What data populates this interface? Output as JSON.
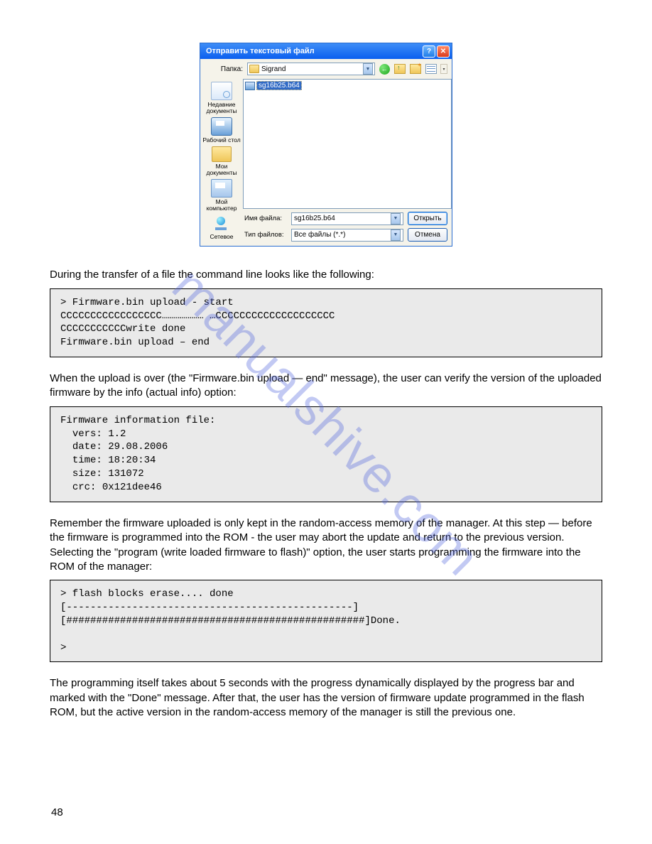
{
  "watermark": "manualshive.com",
  "dialog": {
    "title": "Отправить текстовый файл",
    "help_symbol": "?",
    "close_symbol": "✕",
    "folder_label": "Папка:",
    "folder_value": "Sigrand",
    "file_selected": "sg16b25.b64",
    "places": {
      "recent": "Недавние документы",
      "desktop": "Рабочий стол",
      "mydocs": "Мои документы",
      "mycomp": "Мой компьютер",
      "network": "Сетевое"
    },
    "filename_label": "Имя файла:",
    "filename_value": "sg16b25.b64",
    "filetype_label": "Тип файлов:",
    "filetype_value": "Все файлы (*.*)",
    "open_btn": "Открыть",
    "cancel_btn": "Отмена"
  },
  "prose1": "During the transfer of a file the command line looks like the following:",
  "codebox1": "> Firmware.bin upload - start\nCCCCCCCCCCCCCCCCC………………… …CCCCCCCCCCCCCCCCCCCC\nCCCCCCCCCCCwrite done\nFirmware.bin upload – end",
  "prose2": "When the upload is over (the \"Firmware.bin upload — end\" message), the user can verify the version of the uploaded firmware by the info (actual info) option:",
  "codebox2": "Firmware information file:\n  vers: 1.2\n  date: 29.08.2006\n  time: 18:20:34\n  size: 131072\n  crc: 0x121dee46",
  "prose3": "Remember the firmware uploaded is only kept in the random-access memory of the manager. At this step — before the firmware is programmed into the ROM - the user may abort the update and return to the previous version. Selecting the \"program (write loaded firmware to flash)\" option, the user starts programming the firmware into the ROM of the manager:",
  "codebox3": "> flash blocks erase.... done\n[------------------------------------------------]\n[##################################################]Done.\n\n>",
  "prose4": "The programming itself takes about 5 seconds with the progress dynamically displayed by the progress bar and marked with the \"Done\" message. After that, the user has the version of firmware update programmed in the flash ROM, but the active version in the random-access memory of the manager is still the previous one.",
  "page_number": "48"
}
